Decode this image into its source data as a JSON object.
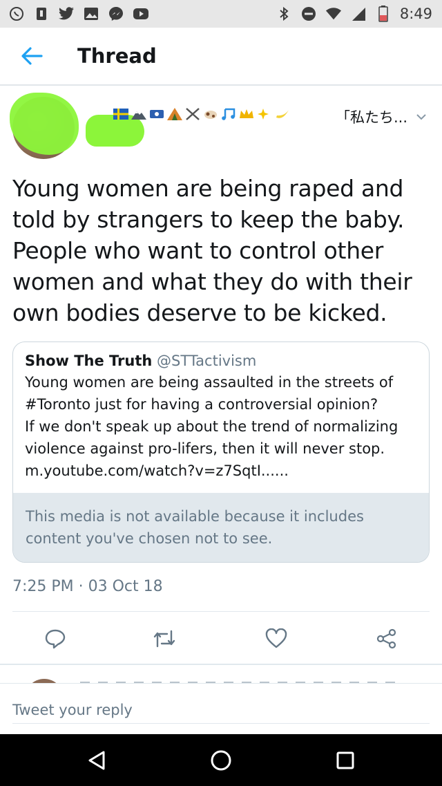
{
  "status_bar": {
    "time": "8:49",
    "left_icons": [
      "whatsapp-icon",
      "notification-icon",
      "twitter-icon",
      "gallery-icon",
      "messenger-icon",
      "youtube-icon"
    ],
    "right_icons": [
      "bluetooth-icon",
      "do-not-disturb-icon",
      "wifi-icon",
      "signal-icon",
      "battery-icon"
    ]
  },
  "header": {
    "title": "Thread",
    "accent_color": "#1da1f2"
  },
  "tweet": {
    "display_name_snippet": "「私たち...",
    "text": "Young women are being raped and told by strangers to keep the baby. People who want to control other women and what they do with their own bodies deserve to be kicked.",
    "timestamp": "7:25 PM · 03 Oct 18"
  },
  "quote": {
    "name": "Show The Truth",
    "handle": "@STTactivism",
    "text_lines": [
      "Young women are being assaulted in the streets of",
      "#Toronto just for having a controversial opinion?",
      "If we don't speak up about the trend of normalizing",
      "violence against pro-lifers, then it will never stop.",
      "m.youtube.com/watch?v=z7SqtI......"
    ],
    "media_notice_lines": [
      "This media is not available because it includes",
      "content you've chosen not to see."
    ]
  },
  "reply": {
    "placeholder": "Tweet your reply"
  }
}
